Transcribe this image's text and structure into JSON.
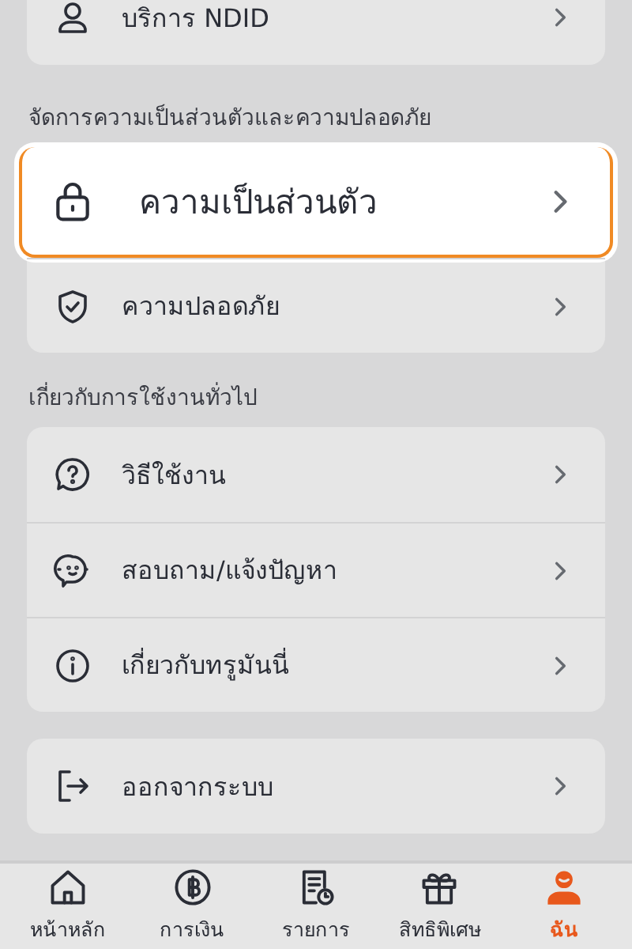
{
  "sections": [
    {
      "items": [
        {
          "kind": "person",
          "label": "บริการ NDID",
          "highlighted": false
        }
      ]
    },
    {
      "title": "จัดการความเป็นส่วนตัวและความปลอดภัย",
      "items": [
        {
          "kind": "lock",
          "label": "ความเป็นส่วนตัว",
          "highlighted": true
        },
        {
          "kind": "shield",
          "label": "ความปลอดภัย",
          "highlighted": false
        }
      ]
    },
    {
      "title": "เกี่ยวกับการใช้งานทั่วไป",
      "items": [
        {
          "kind": "help",
          "label": "วิธีใช้งาน",
          "highlighted": false
        },
        {
          "kind": "bot",
          "label": "สอบถาม/แจ้งปัญหา",
          "highlighted": false
        },
        {
          "kind": "info",
          "label": "เกี่ยวกับทรูมันนี่",
          "highlighted": false
        }
      ]
    },
    {
      "items": [
        {
          "kind": "logout",
          "label": "ออกจากระบบ",
          "highlighted": false
        }
      ]
    }
  ],
  "tabs": [
    {
      "kind": "home",
      "label": "หน้าหลัก",
      "selected": false
    },
    {
      "kind": "coin",
      "label": "การเงิน",
      "selected": false
    },
    {
      "kind": "receipt",
      "label": "รายการ",
      "selected": false
    },
    {
      "kind": "gift",
      "label": "สิทธิพิเศษ",
      "selected": false
    },
    {
      "kind": "user",
      "label": "ฉัน",
      "selected": true
    }
  ]
}
